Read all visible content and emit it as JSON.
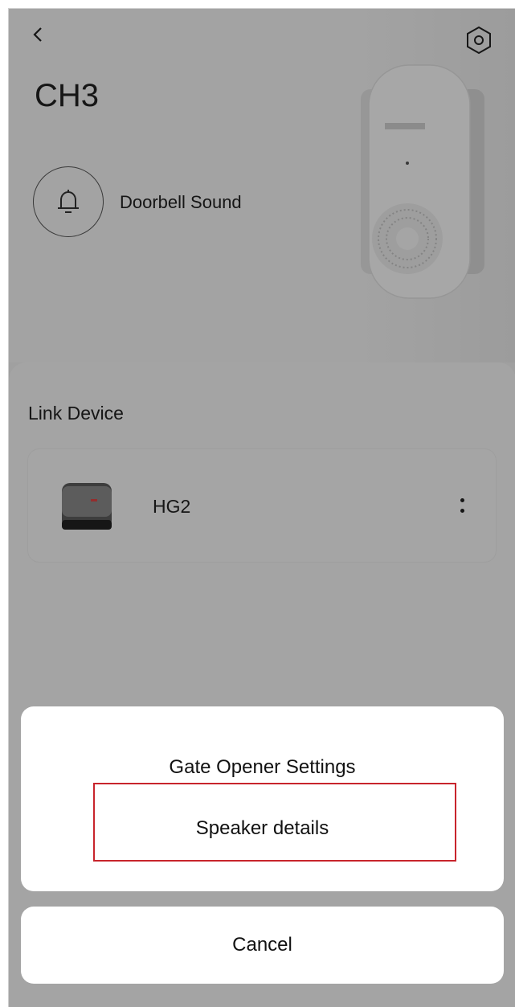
{
  "header": {
    "title": "CH3",
    "back_icon": "chevron-left-icon",
    "settings_icon": "hex-settings-icon"
  },
  "doorbell": {
    "label": "Doorbell Sound",
    "icon": "bell-icon"
  },
  "link_section": {
    "title": "Link Device",
    "devices": [
      {
        "name": "HG2",
        "menu_icon": "more-vertical-icon"
      }
    ]
  },
  "action_sheet": {
    "items": [
      "Gate Opener Settings",
      "Speaker details"
    ],
    "highlighted_item": "Speaker details",
    "cancel_label": "Cancel"
  },
  "colors": {
    "highlight_border": "#c8242c",
    "overlay": "rgba(0,0,0,0.33)",
    "sheet_bg": "#ffffff"
  }
}
